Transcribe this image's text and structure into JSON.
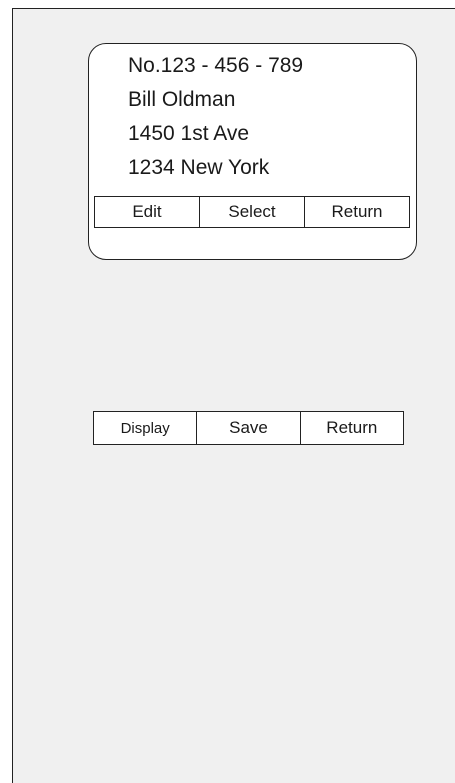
{
  "contact_card": {
    "number_line": "No.123 - 456 - 789",
    "name": "Bill Oldman",
    "street": "1450 1st Ave",
    "city_line": "1234 New York"
  },
  "card_softkeys": {
    "edit": "Edit",
    "select": "Select",
    "return": "Return"
  },
  "bottom_softkeys": {
    "display": "Display",
    "save": "Save",
    "return": "Return"
  }
}
